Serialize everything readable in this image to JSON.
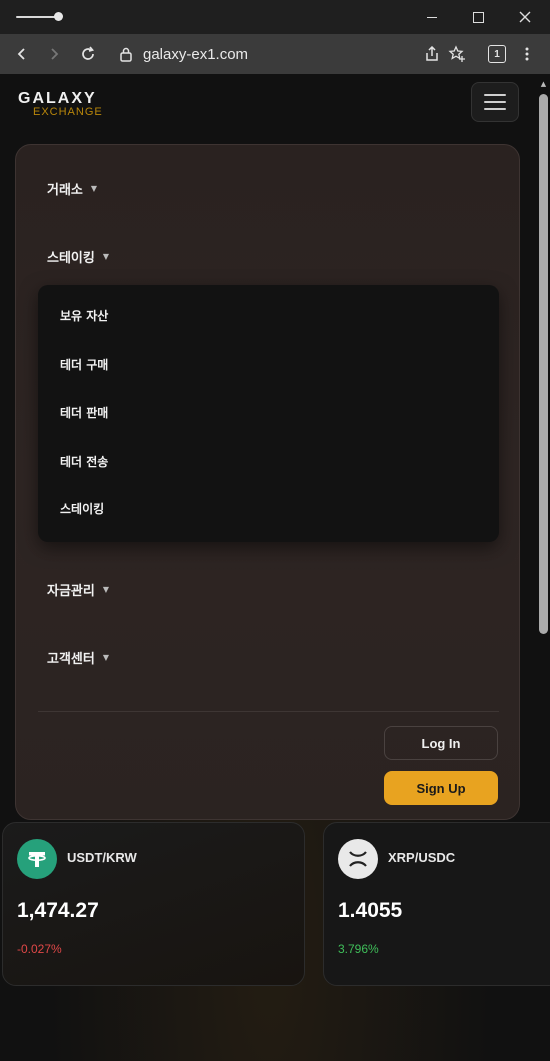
{
  "browser": {
    "url": "galaxy-ex1.com",
    "tab_count": "1"
  },
  "header": {
    "logo_main": "GALAXY",
    "logo_sub": "EXCHANGE"
  },
  "menu": {
    "items": [
      {
        "label": "거래소"
      },
      {
        "label": "스테이킹"
      },
      {
        "label": "자금관리"
      },
      {
        "label": "고객센터"
      }
    ],
    "submenu": [
      {
        "label": "보유 자산"
      },
      {
        "label": "테더 구매"
      },
      {
        "label": "테더 판매"
      },
      {
        "label": "테더 전송"
      },
      {
        "label": "스테이킹"
      }
    ],
    "login_label": "Log In",
    "signup_label": "Sign Up"
  },
  "tickers": [
    {
      "pair": "USDT/KRW",
      "price": "1,474.27",
      "change": "-0.027%",
      "icon": "tether-icon",
      "color": "#26a17b"
    },
    {
      "pair": "XRP/USDC",
      "price": "1.4055",
      "change": "3.796%",
      "icon": "xrp-icon",
      "color": "#e9e9e9"
    }
  ],
  "colors": {
    "accent": "#e8a320",
    "negative": "#e04848",
    "positive": "#3fbf5a"
  }
}
